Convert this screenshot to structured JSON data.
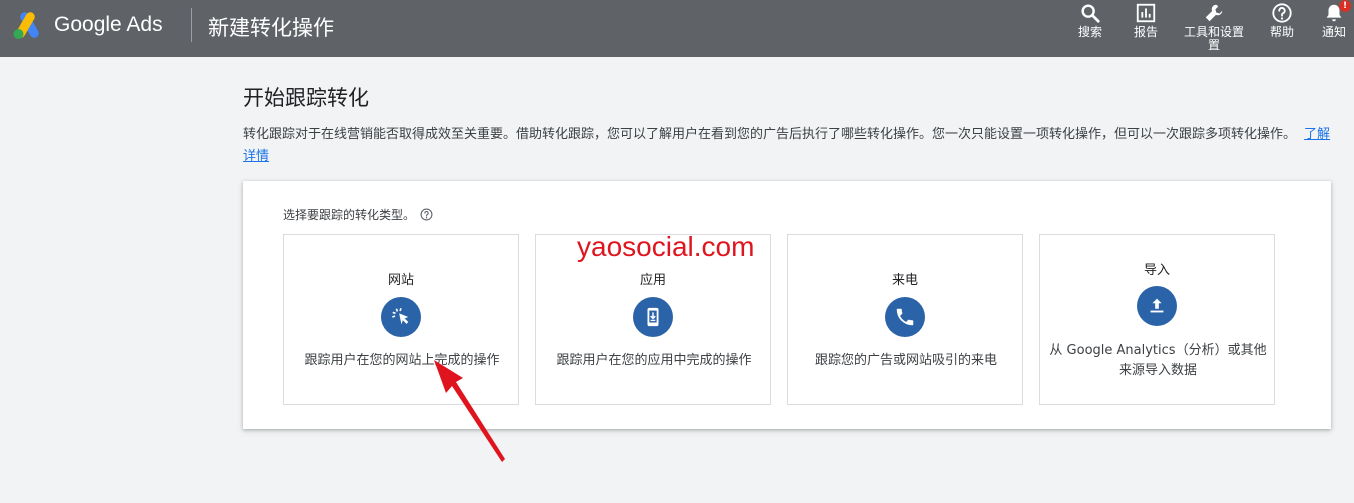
{
  "header": {
    "brand": "Google Ads",
    "page_title": "新建转化操作",
    "nav": [
      {
        "label": "搜索",
        "icon": "search-icon"
      },
      {
        "label": "报告",
        "icon": "bar-chart-icon"
      },
      {
        "label": "工具和设置",
        "label_line2": "置",
        "icon": "wrench-icon"
      },
      {
        "label": "帮助",
        "icon": "help-icon"
      },
      {
        "label": "通知",
        "icon": "bell-icon",
        "badge": "!"
      }
    ]
  },
  "main": {
    "heading": "开始跟踪转化",
    "description": "转化跟踪对于在线营销能否取得成效至关重要。借助转化跟踪，您可以了解用户在看到您的广告后执行了哪些转化操作。您一次只能设置一项转化操作，但可以一次跟踪多项转化操作。",
    "learn_more": "了解详情",
    "prompt": "选择要跟踪的转化类型。",
    "cards": [
      {
        "title": "网站",
        "icon": "cursor-click-icon",
        "desc": "跟踪用户在您的网站上完成的操作"
      },
      {
        "title": "应用",
        "icon": "phone-download-icon",
        "desc": "跟踪用户在您的应用中完成的操作"
      },
      {
        "title": "来电",
        "icon": "phone-call-icon",
        "desc": "跟踪您的广告或网站吸引的来电"
      },
      {
        "title": "导入",
        "icon": "upload-icon",
        "desc": "从 Google Analytics（分析）或其他来源导入数据"
      }
    ]
  },
  "overlay": {
    "watermark": "yaosocial.com"
  },
  "colors": {
    "topbar": "#5f6368",
    "icon_circle": "#2b63a9",
    "link": "#1a73e8",
    "annotation_red": "#e0141e"
  }
}
